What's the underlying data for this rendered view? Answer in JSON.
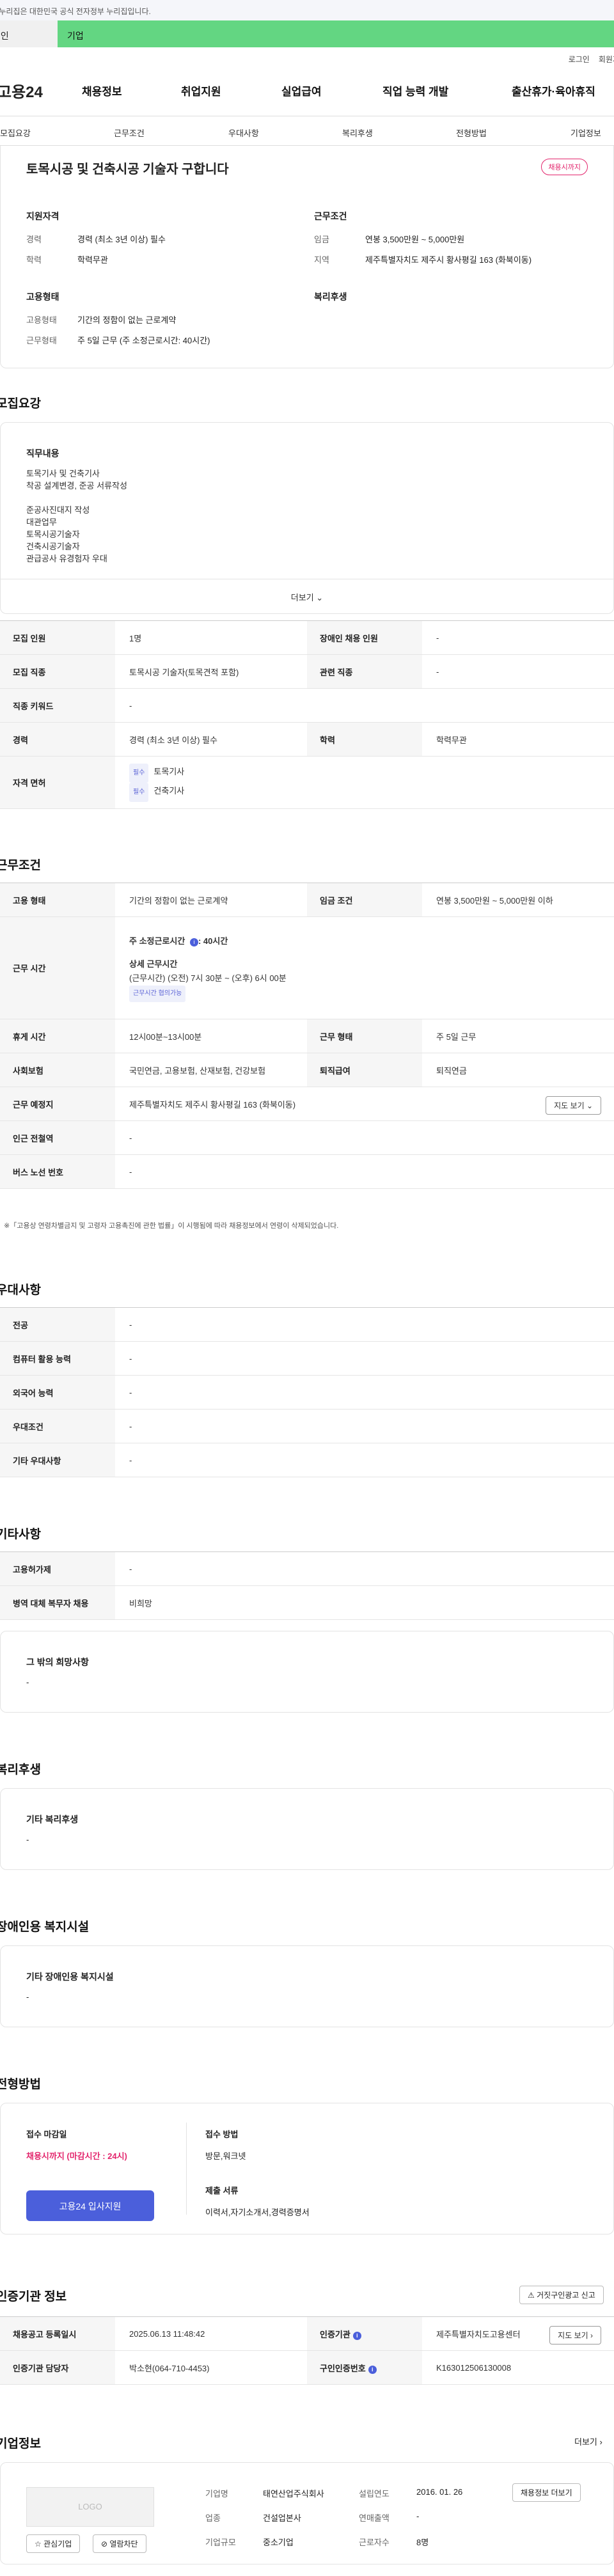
{
  "gov_banner": "이 누리집은 대한민국 공식 전자정부 누리집입니다.",
  "top_tabs": [
    "개인",
    "기업"
  ],
  "util": {
    "login": "로그인",
    "signup": "회원가입"
  },
  "brand": "고용24",
  "gnb": [
    "채용정보",
    "취업지원",
    "실업급여",
    "직업 능력 개발",
    "출산휴가·육아휴직"
  ],
  "anchor_tabs": [
    "모집요강",
    "근무조건",
    "우대사항",
    "복리후생",
    "전형방법",
    "기업정보"
  ],
  "summary": {
    "title": "토목시공 및 건축시공 기술자 구합니다",
    "badge": "채용시까지",
    "qual_head": "지원자격",
    "cond_head": "근무조건",
    "emp_head": "고용형태",
    "welfare_head": "복리후생",
    "career_lbl": "경력",
    "career_val": "경력 (최소 3년 이상) 필수",
    "edu_lbl": "학력",
    "edu_val": "학력무관",
    "wage_lbl": "임금",
    "wage_val": "연봉 3,500만원 ~ 5,000만원",
    "region_lbl": "지역",
    "region_val": "제주특별자치도 제주시 황사평길 163 (화북이동)",
    "emptype_lbl": "고용형태",
    "emptype_val": "기간의 정함이 없는 근로계약",
    "worktype_lbl": "근무형태",
    "worktype_val": "주 5일 근무 (주 소정근로시간: 40시간)"
  },
  "recruit": {
    "heading": "모집요강",
    "duty_head": "직무내용",
    "duty_lines": [
      "토목기사 및 건축기사",
      "착공 설계변경, 준공 서류작성",
      "",
      "준공사진대지 작성",
      "대관업무",
      "토목시공기술자",
      "건축시공기술자",
      "관급공사 유경험자 우대"
    ],
    "more": "더보기",
    "rows": [
      [
        "모집 인원",
        "1명",
        "장애인 채용 인원",
        "-"
      ],
      [
        "모집 직종",
        "토목시공 기술자(토목견적 포함)",
        "관련 직종",
        "-"
      ],
      [
        "직종 키워드",
        "-"
      ],
      [
        "경력",
        "경력 (최소 3년 이상) 필수",
        "학력",
        "학력무관"
      ]
    ],
    "license_lbl": "자격 면허",
    "license_tag": "필수",
    "licenses": [
      "토목기사",
      "건축기사"
    ]
  },
  "work": {
    "heading": "근무조건",
    "emptype_k": "고용 형태",
    "emptype_v": "기간의 정함이 없는 근로계약",
    "wage_k": "임금 조건",
    "wage_v": "연봉 3,500만원 ~ 5,000만원 이하",
    "hours_k": "근무 시간",
    "hours_main_lbl": "주 소정근로시간",
    "hours_main_val": ": 40시간",
    "hours_detail_lbl": "상세 근무시간",
    "hours_detail_val": "(근무시간) (오전) 7시 30분 ~ (오후) 6시 00분",
    "hours_tag": "근무시간 협의가능",
    "break_k": "휴게 시간",
    "break_v": "12시00분~13시00분",
    "form_k": "근무 형태",
    "form_v": "주 5일 근무",
    "ins_k": "사회보험",
    "ins_v": "국민연금, 고용보험, 산재보험, 건강보험",
    "retire_k": "퇴직급여",
    "retire_v": "퇴직연금",
    "place_k": "근무 예정지",
    "place_v": "제주특별자치도 제주시 황사평길 163 (화북이동)",
    "map_btn": "지도 보기",
    "station_k": "인근 전철역",
    "station_v": "-",
    "bus_k": "버스 노선 번호",
    "bus_v": "-",
    "notice": "※「고용상 연령차별금지 및 고령자 고용촉진에 관한 법률」이 시행됨에 따라 채용정보에서 연령이 삭제되었습니다."
  },
  "prefer": {
    "heading": "우대사항",
    "rows": [
      [
        "전공",
        "-"
      ],
      [
        "컴퓨터 활용 능력",
        "-"
      ],
      [
        "외국어 능력",
        "-"
      ],
      [
        "우대조건",
        "-"
      ],
      [
        "기타 우대사항",
        "-"
      ]
    ]
  },
  "etc": {
    "heading": "기타사항",
    "rows": [
      [
        "고용허가제",
        "-"
      ],
      [
        "병역 대체 복무자 채용",
        "비희망"
      ]
    ],
    "other_head": "그 밖의 희망사항",
    "other_val": "-"
  },
  "welfare": {
    "heading": "복리후생",
    "box_head": "기타 복리후생",
    "box_val": "-"
  },
  "disabled": {
    "heading": "장애인용 복지시설",
    "box_head": "기타 장애인용 복지시설",
    "box_val": "-"
  },
  "process": {
    "heading": "전형방법",
    "deadline_head": "접수 마감일",
    "deadline_val": "채용시까지 (마감시간 : 24시)",
    "apply_btn": "고용24 입사지원",
    "method_head": "접수 방법",
    "method_val": "방문,워크넷",
    "docs_head": "제출 서류",
    "docs_val": "이력서,자기소개서,경력증명서"
  },
  "agency": {
    "heading": "인증기관 정보",
    "report_btn": "거짓구인광고 신고",
    "reg_k": "채용공고 등록일시",
    "reg_v": "2025.06.13 11:48:42",
    "agency_k": "인증기관",
    "agency_v": "제주특별자치도고용센터",
    "map_btn": "지도 보기",
    "mgr_k": "인증기관 담당자",
    "mgr_v": "박소현(064-710-4453)",
    "no_k": "구인인증번호",
    "no_v": "K163012506130008"
  },
  "company": {
    "heading": "기업정보",
    "more": "더보기",
    "logo": "LOGO",
    "fav_btn": "관심기업",
    "block_btn": "열람차단",
    "name_k": "기업명",
    "name_v": "태연산업주식회사",
    "year_k": "설립연도",
    "year_v": "2016. 01. 26",
    "ind_k": "업종",
    "ind_v": "건설업본사",
    "sales_k": "연매출액",
    "sales_v": "-",
    "size_k": "기업규모",
    "size_v": "중소기업",
    "emp_k": "근로자수",
    "emp_v": "8명",
    "jobs_btn": "채용정보 더보기"
  }
}
